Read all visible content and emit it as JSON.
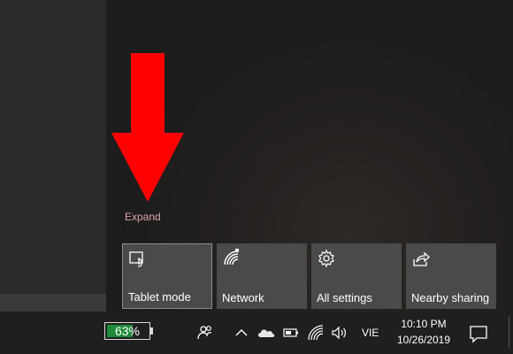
{
  "action_center": {
    "expand_label": "Expand",
    "tiles": [
      {
        "label": "Tablet mode",
        "icon": "tablet-mode-icon",
        "selected": true
      },
      {
        "label": "Network",
        "icon": "network-icon",
        "selected": false
      },
      {
        "label": "All settings",
        "icon": "settings-gear-icon",
        "selected": false
      },
      {
        "label": "Nearby sharing",
        "icon": "nearby-sharing-icon",
        "selected": false
      }
    ]
  },
  "annotation": {
    "arrow_color": "#ff0000",
    "arrow_direction": "down"
  },
  "taskbar": {
    "battery_percent": "63%",
    "battery_level": 0.63,
    "battery_color": "#1e8a3a",
    "tray_icons": [
      "people-icon",
      "chevron-up-icon",
      "cloud-icon",
      "battery-icon",
      "wifi-icon",
      "volume-icon"
    ],
    "language": "VIE",
    "time": "10:10 PM",
    "date": "10/26/2019",
    "notification_icon": "action-center-icon"
  }
}
